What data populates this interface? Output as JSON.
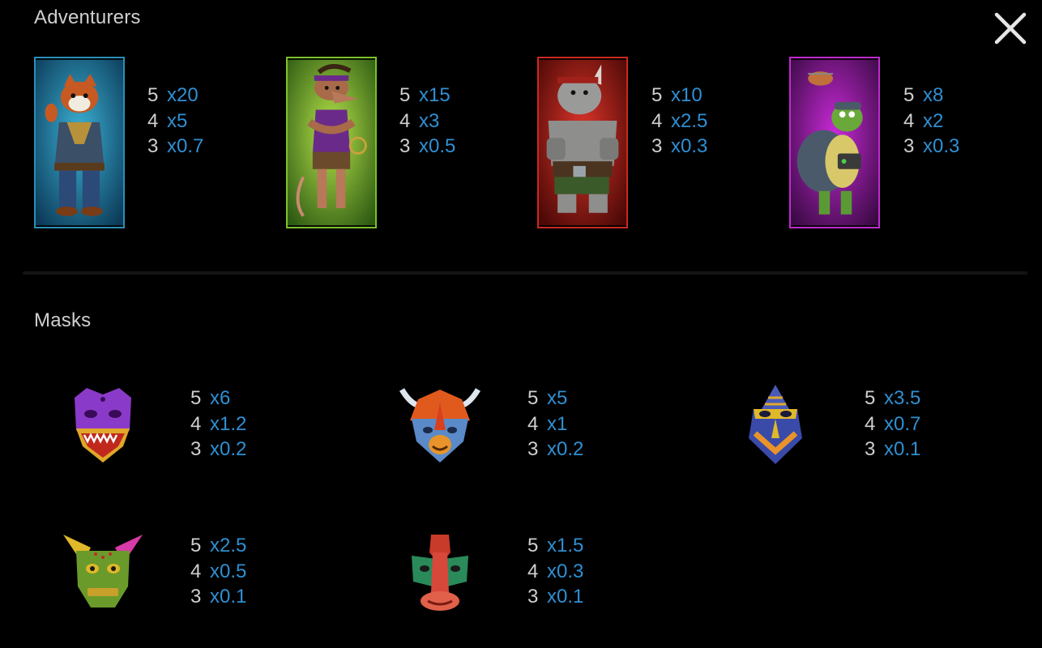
{
  "sections": {
    "adventurers": {
      "title": "Adventurers",
      "symbols": [
        {
          "icon": "red-panda-adventurer-icon",
          "frame_color": "#2a8fb8",
          "pays": [
            {
              "count": "5",
              "mult": "x20"
            },
            {
              "count": "4",
              "mult": "x5"
            },
            {
              "count": "3",
              "mult": "x0.7"
            }
          ]
        },
        {
          "icon": "rat-adventurer-icon",
          "frame_color": "#7cc22a",
          "pays": [
            {
              "count": "5",
              "mult": "x15"
            },
            {
              "count": "4",
              "mult": "x3"
            },
            {
              "count": "3",
              "mult": "x0.5"
            }
          ]
        },
        {
          "icon": "rhino-adventurer-icon",
          "frame_color": "#c92a1e",
          "pays": [
            {
              "count": "5",
              "mult": "x10"
            },
            {
              "count": "4",
              "mult": "x2.5"
            },
            {
              "count": "3",
              "mult": "x0.3"
            }
          ]
        },
        {
          "icon": "turtle-adventurer-icon",
          "frame_color": "#c12ad0",
          "pays": [
            {
              "count": "5",
              "mult": "x8"
            },
            {
              "count": "4",
              "mult": "x2"
            },
            {
              "count": "3",
              "mult": "x0.3"
            }
          ]
        }
      ]
    },
    "masks": {
      "title": "Masks",
      "symbols": [
        {
          "icon": "purple-dragon-mask-icon",
          "pays": [
            {
              "count": "5",
              "mult": "x6"
            },
            {
              "count": "4",
              "mult": "x1.2"
            },
            {
              "count": "3",
              "mult": "x0.2"
            }
          ]
        },
        {
          "icon": "horned-blue-mask-icon",
          "pays": [
            {
              "count": "5",
              "mult": "x5"
            },
            {
              "count": "4",
              "mult": "x1"
            },
            {
              "count": "3",
              "mult": "x0.2"
            }
          ]
        },
        {
          "icon": "blue-gold-mask-icon",
          "pays": [
            {
              "count": "5",
              "mult": "x3.5"
            },
            {
              "count": "4",
              "mult": "x0.7"
            },
            {
              "count": "3",
              "mult": "x0.1"
            }
          ]
        },
        {
          "icon": "green-pink-mask-icon",
          "pays": [
            {
              "count": "5",
              "mult": "x2.5"
            },
            {
              "count": "4",
              "mult": "x0.5"
            },
            {
              "count": "3",
              "mult": "x0.1"
            }
          ]
        },
        {
          "icon": "red-long-mask-icon",
          "pays": [
            {
              "count": "5",
              "mult": "x1.5"
            },
            {
              "count": "4",
              "mult": "x0.3"
            },
            {
              "count": "3",
              "mult": "x0.1"
            }
          ]
        }
      ]
    }
  },
  "colors": {
    "background": "#000000",
    "multiplier": "#2f8fd2",
    "count": "#cfcfcf"
  },
  "close_icon": "close-icon"
}
